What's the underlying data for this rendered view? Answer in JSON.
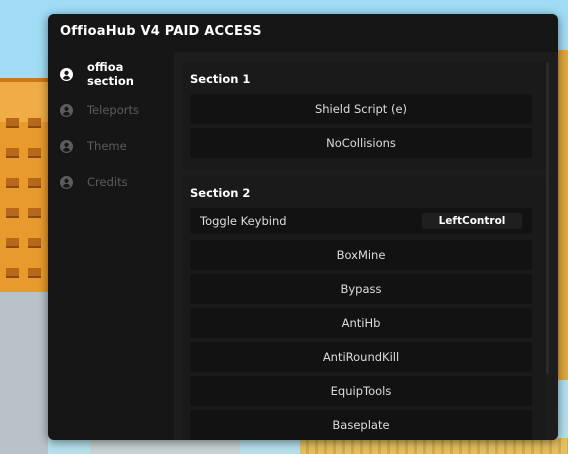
{
  "window": {
    "title": "OffioaHub V4 PAID ACCESS"
  },
  "sidebar": {
    "items": [
      {
        "label": "offioa section",
        "icon": "user-circle-icon",
        "active": true
      },
      {
        "label": "Teleports",
        "icon": "user-circle-icon",
        "active": false
      },
      {
        "label": "Theme",
        "icon": "user-circle-icon",
        "active": false
      },
      {
        "label": "Credits",
        "icon": "user-circle-icon",
        "active": false
      }
    ]
  },
  "sections": [
    {
      "title": "Section 1",
      "buttons": [
        "Shield Script (e)",
        "NoCollisions"
      ]
    },
    {
      "title": "Section 2",
      "keybind": {
        "label": "Toggle Keybind",
        "value": "LeftControl"
      },
      "buttons": [
        "BoxMine",
        "Bypass",
        "AntiHb",
        "AntiRoundKill",
        "EquipTools",
        "Baseplate"
      ]
    }
  ],
  "colors": {
    "window_bg": "#161616",
    "content_bg": "#1d1d1d",
    "button_bg": "#121212",
    "active_text": "#ffffff",
    "inactive_text": "#5c5c5c"
  }
}
